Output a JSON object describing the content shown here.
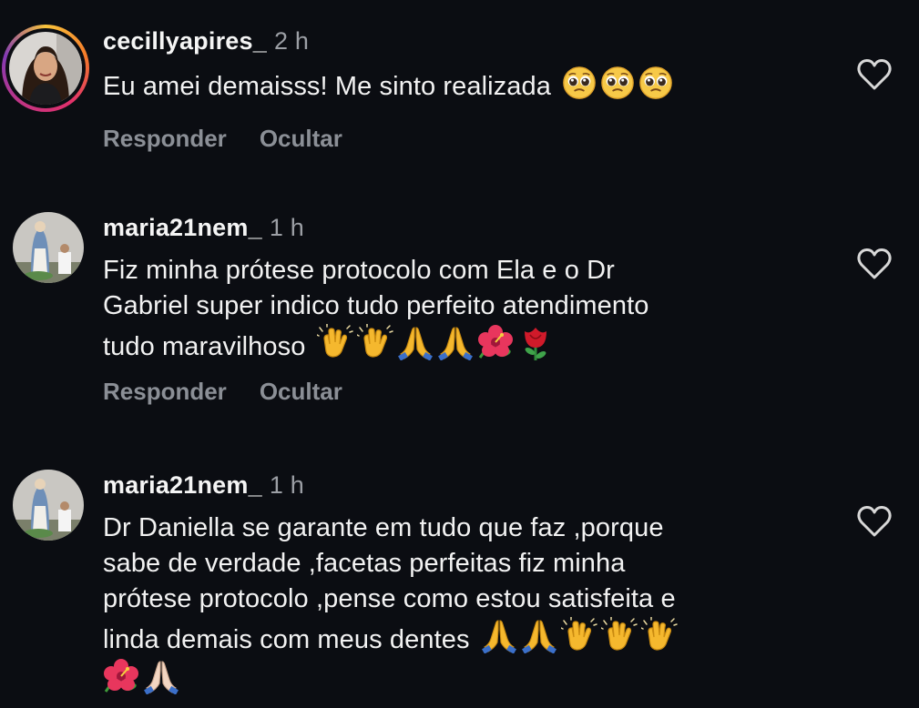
{
  "comments": [
    {
      "username": "cecillyapires_",
      "time": "2 h",
      "text": "Eu amei demaisss! Me sinto realizada",
      "emojis": [
        "pleading-face",
        "pleading-face",
        "pleading-face"
      ],
      "reply_label": "Responder",
      "hide_label": "Ocultar",
      "story_ring": true
    },
    {
      "username": "maria21nem_",
      "time": "1 h",
      "text_lines": [
        "Fiz minha prótese protocolo com  Ela e o Dr",
        "Gabriel super indico tudo perfeito atendimento",
        "tudo maravilhoso"
      ],
      "emojis": [
        "clapping-hands",
        "clapping-hands",
        "folded-hands",
        "folded-hands",
        "hibiscus",
        "rose"
      ],
      "reply_label": "Responder",
      "hide_label": "Ocultar",
      "story_ring": false
    },
    {
      "username": "maria21nem_",
      "time": "1 h",
      "text_lines": [
        "Dr Daniella se garante  em tudo que faz ,porque",
        "sabe  de verdade ,facetas perfeitas fiz minha",
        "prótese protocolo ,pense como estou satisfeita e",
        "linda demais com meus dentes"
      ],
      "emojis": [
        "folded-hands",
        "folded-hands",
        "clapping-hands",
        "clapping-hands",
        "clapping-hands",
        "hibiscus",
        "folded-hands-light"
      ],
      "story_ring": false
    }
  ],
  "colors": {
    "background": "#0b0d12",
    "text": "#f2f2f2",
    "muted": "#8b8f96"
  }
}
